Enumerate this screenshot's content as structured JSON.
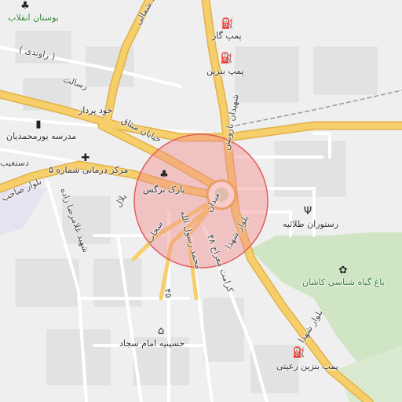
{
  "map": {
    "colors": {
      "background": "#efefef",
      "major_road": "#f6cf6a",
      "major_road_casing": "#e1b04a",
      "minor_road": "#ffffff",
      "green_area": "#cfe5c3",
      "highlight_circle_fill": "#f28b8b",
      "highlight_circle_stroke": "#e06060",
      "rail": "#9a9a9a"
    },
    "labels": {
      "bostan_enghelab": "بوستان انقلاب",
      "pomp_gaz": "پمپ گاز",
      "pomp_benzin": "پمپ بنزین",
      "khod_pardaz": "خود پرداز",
      "madrese": "مدرسه یورمحمدیان",
      "markaz_darmani": "مرکز درمانی شماره ۵",
      "park_narges": "پارک نرگس",
      "meydan": "میدان",
      "restoran": "رستوران طلائیه",
      "bagh": "باغ گیاه شناسی کاشان",
      "hosseinieh": "حسینیه امام سجاد",
      "pomp_benzin_raeisi": "پمپ بنزین رعیتی",
      "road_ravandi": "( راوندی )",
      "road_resalat": "رسالت",
      "road_shoahadaye": "شهیدان باهنر",
      "road_shahid_madani": "خیابان میثاق",
      "road_dastgheyb": "دستغیب",
      "road_bolvar_shahid": "بلوار شهدا",
      "road_bolvar_shahid2": "بلوار شهدا",
      "road_bolvar_saheb": "بلوار صاحب",
      "road_shahid_gharazi": "شهید غلامرضا زاده",
      "road_shahid_shomali": "شهید شمالی",
      "road_mahmoud": "محمد رسول الله",
      "road_karimi": "کرامت معراج ۴۸",
      "road_shahid_bahonar": "شهیدان بارویش",
      "road_bolvar": "بلال",
      "road_45": "۴۵",
      "road_sahab": "سحاب"
    },
    "icons": [
      "tree-icon",
      "fuel-station-icon",
      "atm-icon",
      "school-icon",
      "medical-cross-icon",
      "restaurant-icon",
      "garden-icon",
      "place-of-worship-icon"
    ]
  }
}
